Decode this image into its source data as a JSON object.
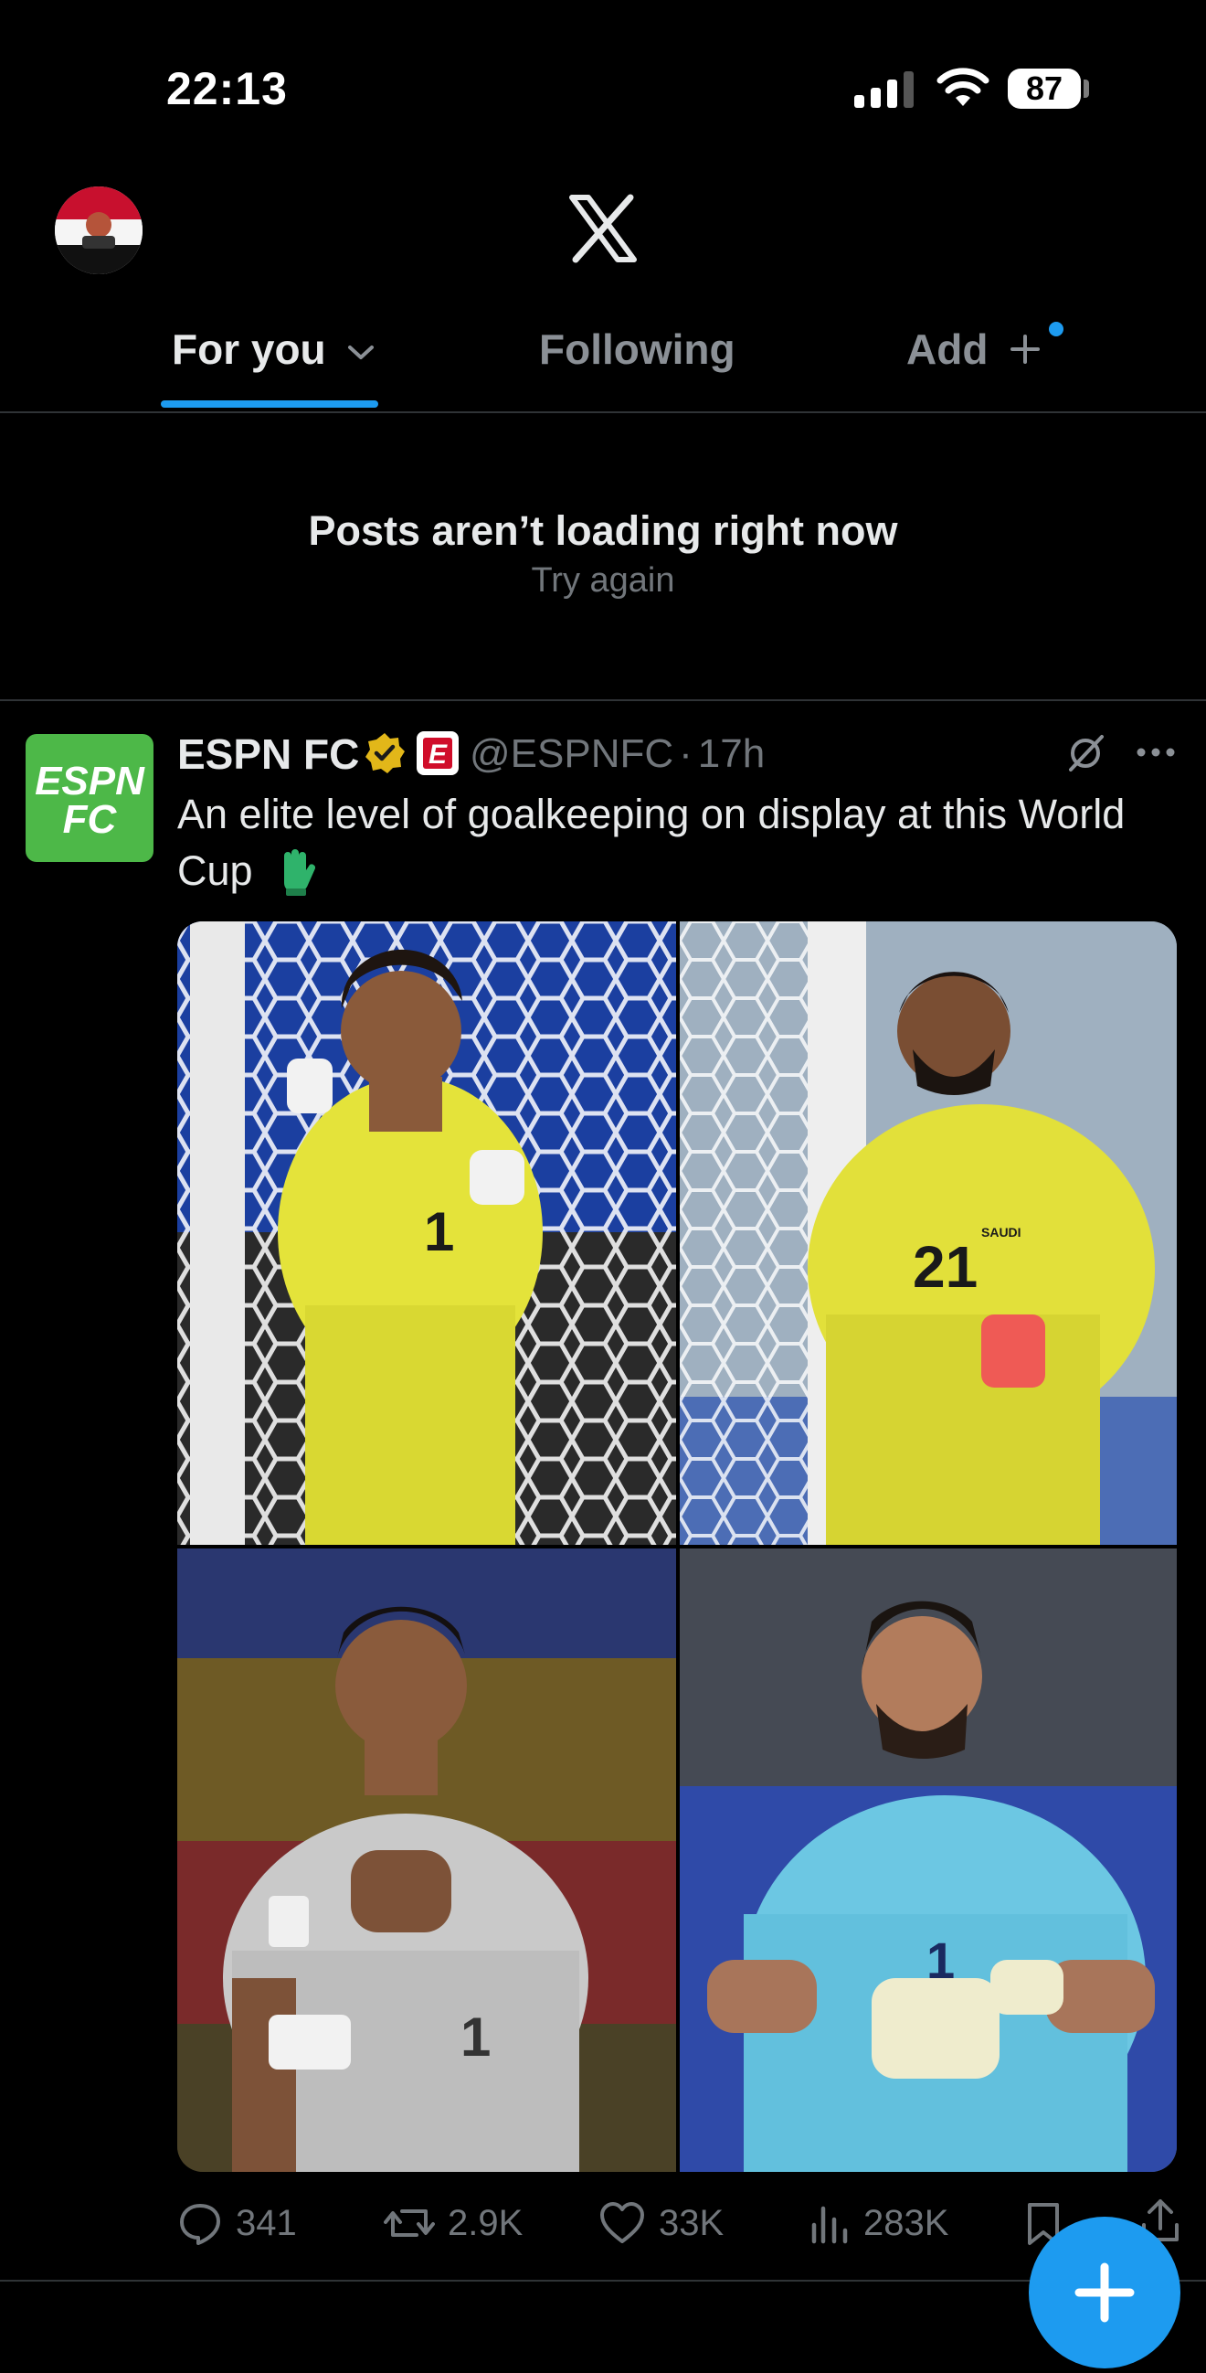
{
  "status_bar": {
    "time": "22:13",
    "battery": "87"
  },
  "header": {
    "tabs": [
      {
        "label": "For you",
        "selected": true
      },
      {
        "label": "Following",
        "selected": false
      },
      {
        "label": "Add",
        "selected": false
      }
    ]
  },
  "error": {
    "title": "Posts aren’t loading right now",
    "retry": "Try again"
  },
  "post": {
    "name": "ESPN FC",
    "handle": "@ESPNFC",
    "separator": "·",
    "time": "17h",
    "text": "An elite level of goalkeeping on display at this World Cup",
    "avatar_text": [
      "ESPN",
      "FC"
    ],
    "affiliate_badge": "E",
    "jersey_numbers": [
      "1",
      "21",
      "1",
      "1"
    ],
    "shirt_text": [
      "SAUDI"
    ],
    "stats": {
      "replies": "341",
      "reposts": "2.9K",
      "likes": "33K",
      "views": "283K"
    }
  },
  "colors": {
    "accent": "#1d9bf0",
    "background": "#000000",
    "primary_text": "#e7e9ea",
    "secondary_text": "#71767b",
    "verified_gold": "#e2b719",
    "espn_green": "#4db848",
    "espn_red": "#d00d2a"
  },
  "icons": {
    "chevron": "chevron-down-icon",
    "add": "plus-icon",
    "verified": "verified-badge-icon",
    "grok": "grok-icon",
    "more": "more-icon",
    "reply": "reply-icon",
    "repost": "repost-icon",
    "like": "heart-icon",
    "views": "views-icon",
    "bookmark": "bookmark-icon",
    "share": "share-icon",
    "compose": "compose-plus-icon"
  }
}
